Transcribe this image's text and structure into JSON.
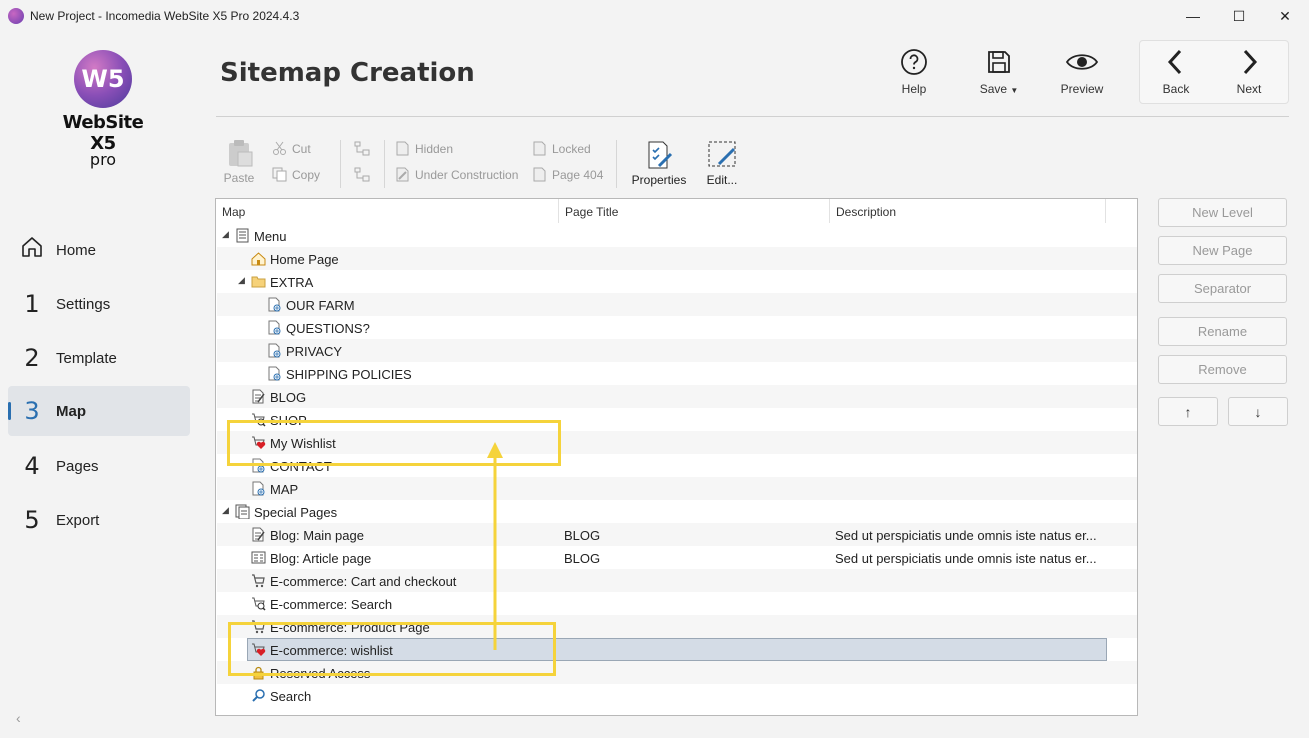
{
  "window": {
    "title": "New Project - Incomedia WebSite X5 Pro 2024.4.3",
    "minimize": "—",
    "maximize": "☐",
    "close": "✕"
  },
  "logo": {
    "badge": "W5",
    "name": "WebSite X5",
    "edition": "pro"
  },
  "nav": [
    {
      "num": "⌂",
      "label": "Home"
    },
    {
      "num": "1",
      "label": "Settings"
    },
    {
      "num": "2",
      "label": "Template"
    },
    {
      "num": "3",
      "label": "Map"
    },
    {
      "num": "4",
      "label": "Pages"
    },
    {
      "num": "5",
      "label": "Export"
    }
  ],
  "header": {
    "title": "Sitemap Creation",
    "help": "Help",
    "save": "Save",
    "preview": "Preview",
    "back": "Back",
    "next": "Next"
  },
  "toolbar": {
    "paste": "Paste",
    "cut": "Cut",
    "copy": "Copy",
    "hidden": "Hidden",
    "under_construction": "Under Construction",
    "locked": "Locked",
    "page404": "Page 404",
    "properties": "Properties",
    "edit": "Edit..."
  },
  "map": {
    "columns": [
      "Map",
      "Page Title",
      "Description"
    ],
    "rows": [
      {
        "label": "Menu",
        "title": "",
        "desc": "",
        "icon": "menu-icon"
      },
      {
        "label": "Home Page",
        "title": "",
        "desc": "",
        "icon": "home-page-icon"
      },
      {
        "label": "EXTRA",
        "title": "",
        "desc": "",
        "icon": "folder-icon"
      },
      {
        "label": "OUR FARM",
        "title": "",
        "desc": "",
        "icon": "page-icon"
      },
      {
        "label": "QUESTIONS?",
        "title": "",
        "desc": "",
        "icon": "page-icon"
      },
      {
        "label": "PRIVACY",
        "title": "",
        "desc": "",
        "icon": "page-icon"
      },
      {
        "label": "SHIPPING POLICIES",
        "title": "",
        "desc": "",
        "icon": "page-icon"
      },
      {
        "label": "BLOG",
        "title": "",
        "desc": "",
        "icon": "blog-icon"
      },
      {
        "label": "SHOP",
        "title": "",
        "desc": "",
        "icon": "shop-search-icon"
      },
      {
        "label": "My Wishlist",
        "title": "",
        "desc": "",
        "icon": "wishlist-icon"
      },
      {
        "label": "CONTACT",
        "title": "",
        "desc": "",
        "icon": "page-icon"
      },
      {
        "label": "MAP",
        "title": "",
        "desc": "",
        "icon": "page-icon"
      },
      {
        "label": "Special Pages",
        "title": "",
        "desc": "",
        "icon": "special-pages-icon"
      },
      {
        "label": "Blog: Main page",
        "title": "BLOG",
        "desc": "Sed ut perspiciatis unde omnis iste natus er...",
        "icon": "blog-icon"
      },
      {
        "label": "Blog: Article page",
        "title": "BLOG",
        "desc": "Sed ut perspiciatis unde omnis iste natus er...",
        "icon": "article-icon"
      },
      {
        "label": "E-commerce: Cart and checkout",
        "title": "",
        "desc": "",
        "icon": "cart-icon"
      },
      {
        "label": "E-commerce: Search",
        "title": "",
        "desc": "",
        "icon": "shop-search-icon"
      },
      {
        "label": "E-commerce: Product Page",
        "title": "",
        "desc": "",
        "icon": "cart-icon"
      },
      {
        "label": "E-commerce: wishlist",
        "title": "",
        "desc": "",
        "icon": "wishlist-icon"
      },
      {
        "label": "Reserved Access",
        "title": "",
        "desc": "",
        "icon": "lock-icon"
      },
      {
        "label": "Search",
        "title": "",
        "desc": "",
        "icon": "search-icon"
      }
    ]
  },
  "side_buttons": {
    "new_level": "New Level",
    "new_page": "New Page",
    "separator": "Separator",
    "rename": "Rename",
    "remove": "Remove",
    "up": "↑",
    "down": "↓"
  },
  "annotation_color": "#f5d33b",
  "accent": "#2a6fb0"
}
